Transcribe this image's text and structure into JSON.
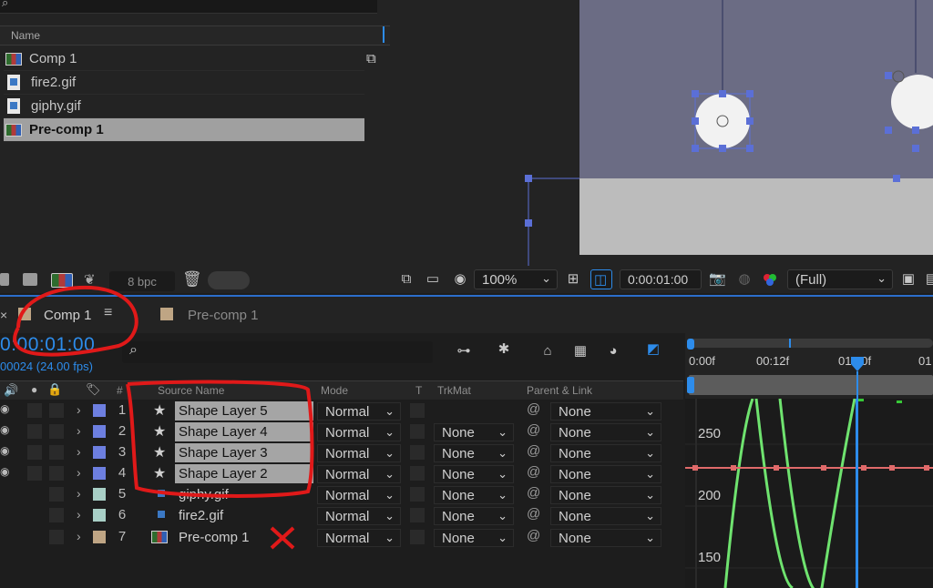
{
  "project": {
    "column_name": "Name",
    "items": [
      {
        "name": "Comp 1",
        "type": "comp",
        "selected": false
      },
      {
        "name": "fire2.gif",
        "type": "gif",
        "selected": false
      },
      {
        "name": "giphy.gif",
        "type": "gif",
        "selected": false
      },
      {
        "name": "Pre-comp 1",
        "type": "comp",
        "selected": true
      }
    ],
    "bit_depth": "8 bpc"
  },
  "viewer": {
    "zoom": "100%",
    "timecode": "0:00:01:00",
    "resolution": "(Full)"
  },
  "tabs": [
    {
      "label": "Comp 1",
      "active": true
    },
    {
      "label": "Pre-comp 1",
      "active": false
    }
  ],
  "timeline": {
    "current_time": "0:00:01:00",
    "frame_info": "00024 (24.00 fps)",
    "columns": {
      "num": "#",
      "source": "Source Name",
      "mode": "Mode",
      "t": "T",
      "trkmat": "TrkMat",
      "parent": "Parent & Link"
    },
    "ruler_labels": [
      "0:00f",
      "00:12f",
      "01:00f",
      "01"
    ],
    "layers": [
      {
        "num": "1",
        "name": "Shape Layer 5",
        "type": "shape",
        "label_color": "#6d7fe0",
        "mode": "Normal",
        "trkmat": "",
        "parent": "None"
      },
      {
        "num": "2",
        "name": "Shape Layer 4",
        "type": "shape",
        "label_color": "#6d7fe0",
        "mode": "Normal",
        "trkmat": "None",
        "parent": "None"
      },
      {
        "num": "3",
        "name": "Shape Layer 3",
        "type": "shape",
        "label_color": "#6d7fe0",
        "mode": "Normal",
        "trkmat": "None",
        "parent": "None"
      },
      {
        "num": "4",
        "name": "Shape Layer 2",
        "type": "shape",
        "label_color": "#6d7fe0",
        "mode": "Normal",
        "trkmat": "None",
        "parent": "None"
      },
      {
        "num": "5",
        "name": "giphy.gif",
        "type": "gif",
        "label_color": "#a8cfc6",
        "mode": "Normal",
        "trkmat": "None",
        "parent": "None"
      },
      {
        "num": "6",
        "name": "fire2.gif",
        "type": "gif",
        "label_color": "#a8cfc6",
        "mode": "Normal",
        "trkmat": "None",
        "parent": "None"
      },
      {
        "num": "7",
        "name": "Pre-comp 1",
        "type": "comp",
        "label_color": "#bfa584",
        "mode": "Normal",
        "trkmat": "None",
        "parent": "None"
      }
    ],
    "graph_labels": [
      "250",
      "200",
      "150"
    ]
  }
}
